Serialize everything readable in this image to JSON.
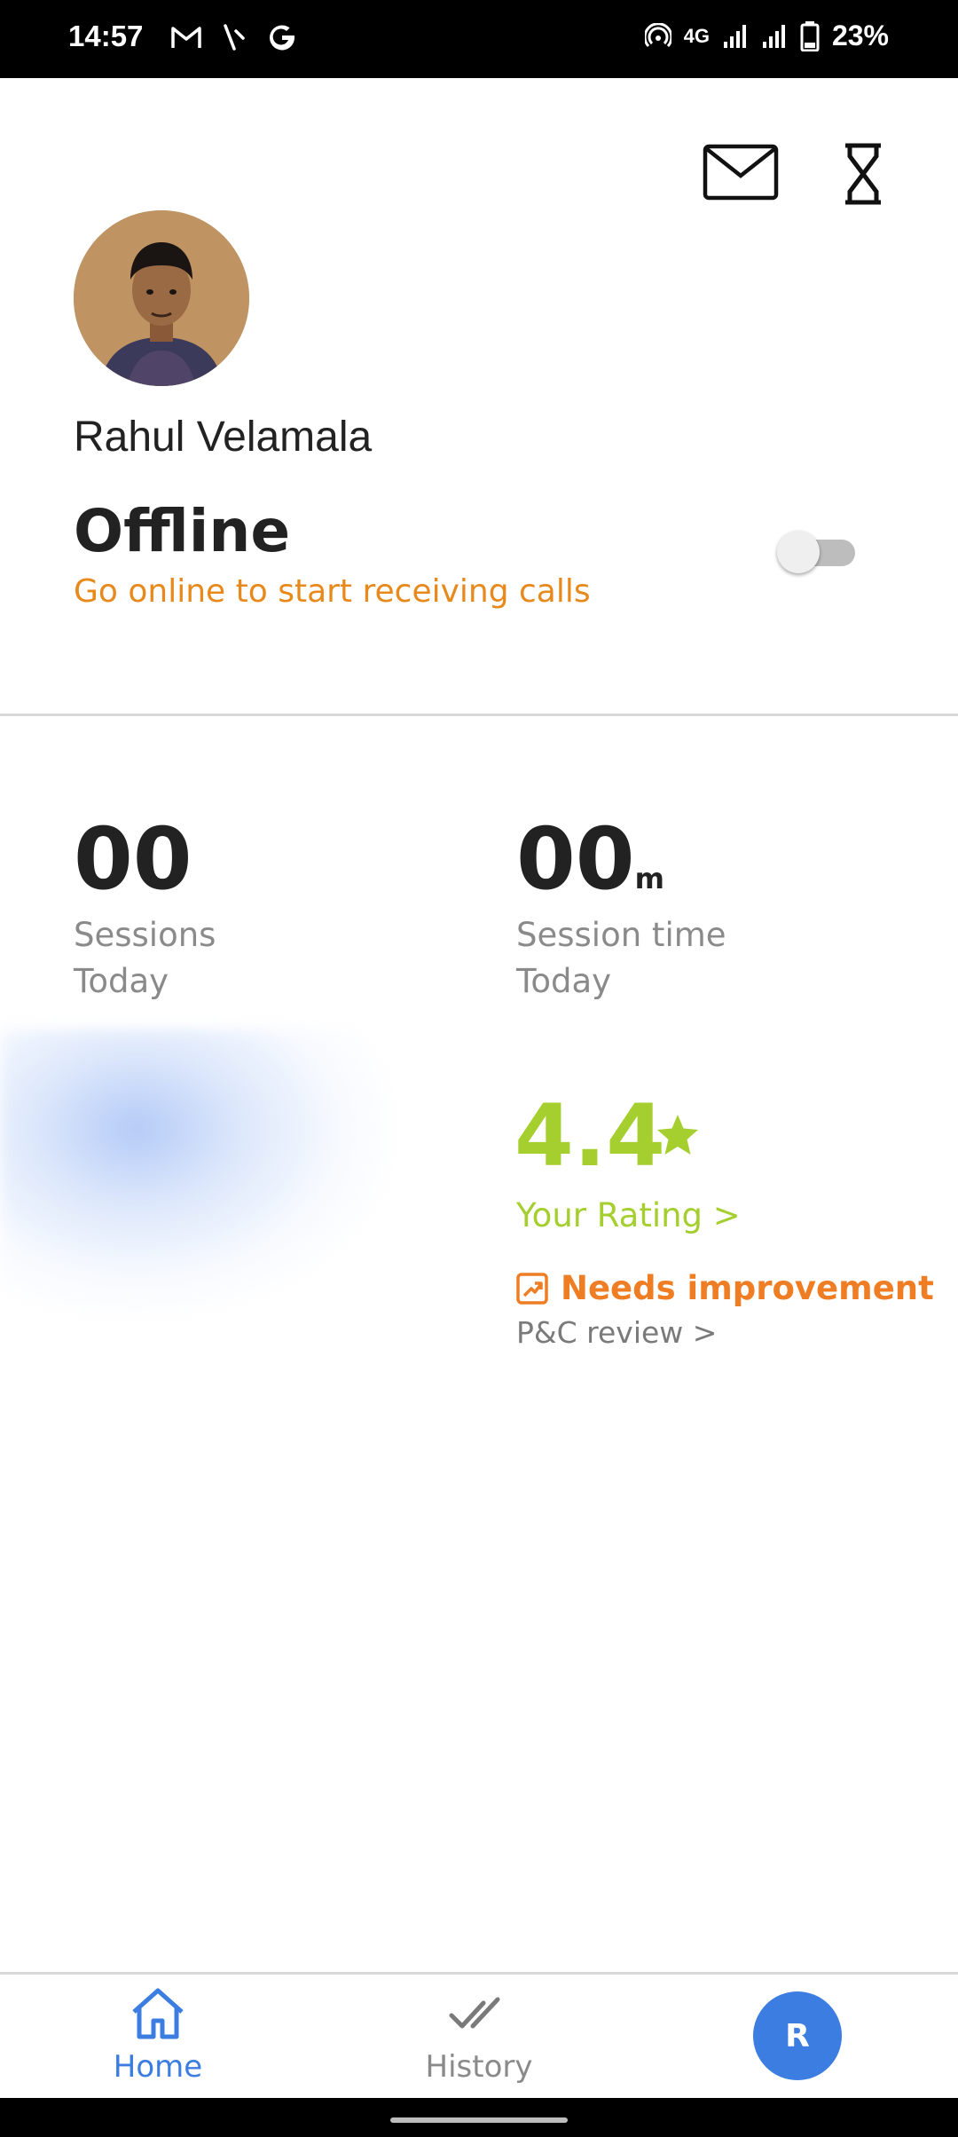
{
  "status_bar": {
    "time": "14:57",
    "network": "4G",
    "battery": "23%",
    "left_icons": [
      "gmail-icon",
      "phone-missed-icon",
      "google-icon"
    ],
    "right_icons": [
      "hotspot-icon",
      "signal-icon",
      "signal-icon",
      "battery-icon"
    ]
  },
  "header": {
    "icons": [
      "mail-icon",
      "hourglass-icon"
    ]
  },
  "profile": {
    "name": "Rahul Velamala",
    "status_title": "Offline",
    "status_subtitle": "Go online to start receiving calls",
    "online_toggle": false
  },
  "stats": {
    "sessions": {
      "value": "00",
      "label_line1": "Sessions",
      "label_line2": "Today"
    },
    "session_time": {
      "value": "00",
      "unit": "m",
      "label_line1": "Session time",
      "label_line2": "Today"
    }
  },
  "rating": {
    "value": "4.4",
    "link": "Your Rating >",
    "improvement": "Needs improvement",
    "review_link": "P&C review >"
  },
  "bottom_nav": {
    "home": "Home",
    "history": "History",
    "profile_initial": "R"
  },
  "colors": {
    "accent_blue": "#3b7de0",
    "rating_green": "#a4cf2e",
    "warning_orange": "#ef7d23",
    "offline_orange": "#e8891c"
  }
}
